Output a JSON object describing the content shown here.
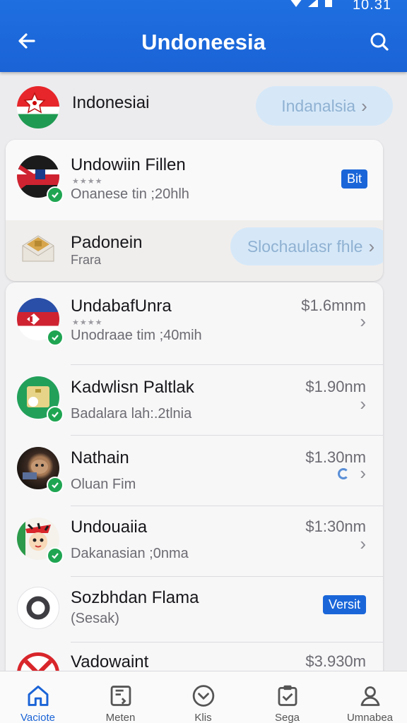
{
  "status_bar": {
    "time": "10.31"
  },
  "header": {
    "title": "Undoneesia"
  },
  "top_row": {
    "name": "Indonesiai",
    "button_label": "Indanalsia"
  },
  "card": {
    "rows": [
      {
        "name": "Undowiin Fillen",
        "stars": "★★★★",
        "subtitle": "Onanese tin ;20hlh",
        "badge": "Bit"
      },
      {
        "name": "Padonein",
        "subtitle": "Frara",
        "button_label": "Slochaulasr fhle"
      }
    ]
  },
  "list": {
    "items": [
      {
        "name": "UndabafUnra",
        "stars": "★★★★",
        "subtitle": "Unodraae tim ;40mih",
        "price": "$1.6mnm"
      },
      {
        "name": "Kadwlisn Paltlak",
        "subtitle": "Badalara lah:.2tlnia",
        "price": "$1.90nm"
      },
      {
        "name": "Nathain",
        "subtitle": "Oluan Fim",
        "price": "$1.30nm"
      },
      {
        "name": "Undouaiia",
        "subtitle": "Dakanasian ;0nma",
        "price": "$1:30nm"
      },
      {
        "name": "Sozbhdan Flama",
        "subtitle": "(Sesak)",
        "badge": "Versit"
      },
      {
        "name": "Vadowaint",
        "price": "$3.930m"
      }
    ]
  },
  "bottom_nav": {
    "items": [
      {
        "label": "Vaciote",
        "icon": "home-icon"
      },
      {
        "label": "Meten",
        "icon": "document-icon"
      },
      {
        "label": "Klis",
        "icon": "heart-circle-icon"
      },
      {
        "label": "Sega",
        "icon": "clipboard-check-icon"
      },
      {
        "label": "Umnabea",
        "icon": "person-icon"
      }
    ]
  },
  "colors": {
    "primary": "#1a63d6",
    "verified": "#1fa552",
    "pill_bg": "#d6e8f8"
  }
}
